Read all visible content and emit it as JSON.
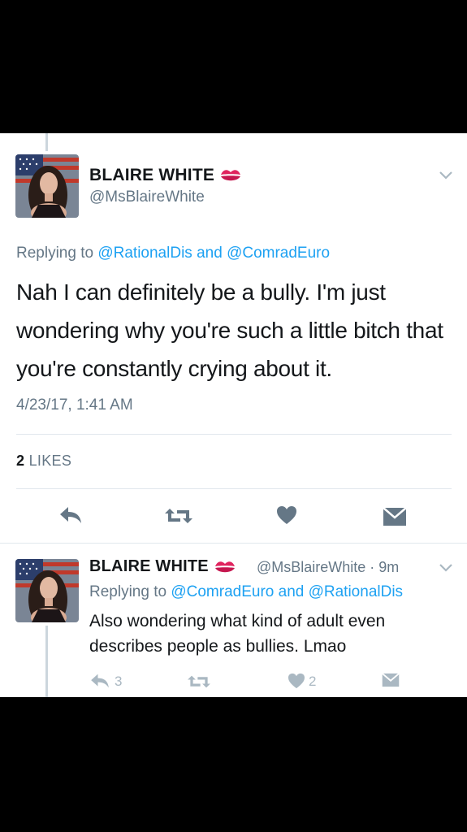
{
  "main_tweet": {
    "author_name": "BLAIRE WHITE",
    "author_handle": "@MsBlaireWhite",
    "replying_prefix": "Replying to",
    "reply_user_1": "@RationalDis",
    "reply_and": "and",
    "reply_user_2": "@ComradEuro",
    "text": "Nah I can definitely be a bully. I'm just wondering why you're such a little bitch that you're constantly crying about it.",
    "timestamp": "4/23/17, 1:41 AM",
    "likes_count": "2",
    "likes_label": "LIKES"
  },
  "reply_tweet": {
    "author_name": "BLAIRE WHITE",
    "handle_time": "@MsBlaireWhite · 9m",
    "replying_prefix": "Replying to",
    "reply_user_1": "@ComradEuro",
    "reply_and": "and",
    "reply_user_2": "@RationalDis",
    "text": "Also wondering what kind of adult even describes people as bullies. Lmao",
    "reply_count": "3",
    "like_count": "2"
  },
  "icons": [
    "kiss-lips-icon",
    "chevron-down-icon",
    "reply-icon",
    "retweet-icon",
    "heart-icon",
    "direct-message-icon"
  ],
  "colors": {
    "link": "#1da1f2",
    "secondary_text": "#657786",
    "icon_main": "#657786",
    "icon_muted": "#aab8c2"
  }
}
